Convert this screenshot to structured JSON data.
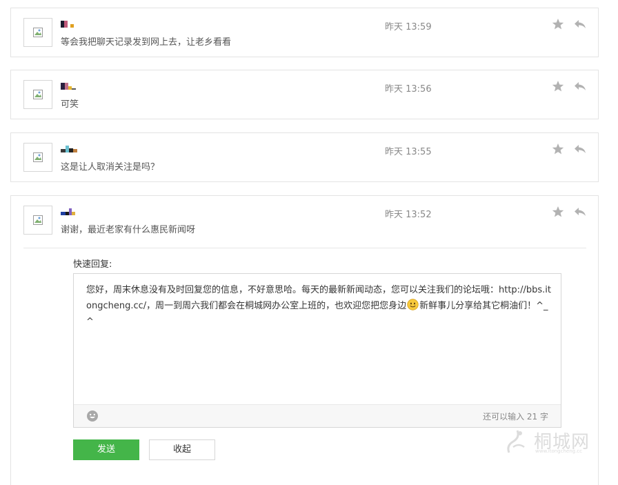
{
  "messages": [
    {
      "text": "等会我把聊天记录发到网上去，让老乡看看",
      "time": "昨天 13:59",
      "nick_colors": [
        "#1a1a2e",
        "#c05a7a",
        "#ffffff",
        "#e0a020"
      ]
    },
    {
      "text": "可笑",
      "time": "昨天 13:56",
      "nick_colors": [
        "#2a2040",
        "#c0708a",
        "#e8b830",
        "#555555"
      ]
    },
    {
      "text": "这是让人取消关注是吗？",
      "time": "昨天 13:55",
      "nick_colors": [
        "#3a3a3a",
        "#6ac0d0",
        "#222222",
        "#c08040"
      ]
    },
    {
      "text": "谢谢，最近老家有什么惠民新闻呀",
      "time": "昨天 13:52",
      "nick_colors": [
        "#2040a0",
        "#1a1a1a",
        "#8060c0",
        "#e0b040"
      ]
    }
  ],
  "quick_reply": {
    "label": "快速回复:",
    "text_part1": "您好，周末休息没有及时回复您的信息，不好意思哈。每天的最新新闻动态，您可以关注我们的论坛哦：http://bbs.itongcheng.cc/，周一到周六我们都会在桐城网办公室上班的，也欢迎您把您身边",
    "text_part2": "新鲜事儿分享给其它桐油们！^_^",
    "counter": "还可以输入 21 字",
    "send_label": "发送",
    "collapse_label": "收起"
  },
  "watermark": {
    "text": "桐城网",
    "url": "www.itongcheng.cc"
  },
  "icons": {
    "star": "star-icon",
    "reply": "reply-arrow-icon",
    "face": "emoji-face-icon",
    "broken_image": "broken-image-icon"
  },
  "colors": {
    "send_button": "#44b549",
    "time": "#888888",
    "icon_gray": "#b2b2b2"
  }
}
